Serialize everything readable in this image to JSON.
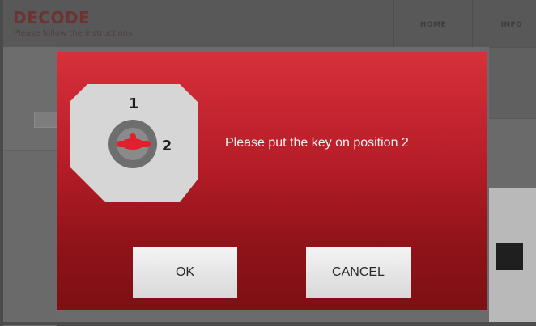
{
  "header": {
    "title": "DECODE",
    "subtitle": "Please follow the instructions",
    "nav": {
      "home": "HOME",
      "info": "INFO"
    }
  },
  "dialog": {
    "message": "Please put the key on position 2",
    "positions": {
      "first": "1",
      "second": "2"
    },
    "ok_label": "OK",
    "cancel_label": "CANCEL"
  },
  "colors": {
    "dialog_top": "#d7303b",
    "dialog_bottom": "#7d1014",
    "key_position_marker": "#e0202c"
  }
}
